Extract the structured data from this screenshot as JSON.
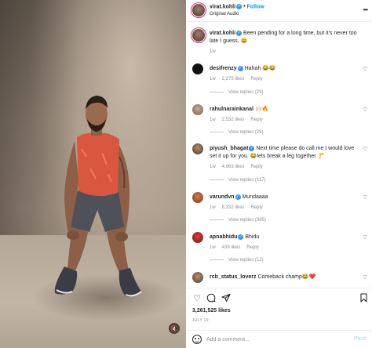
{
  "post": {
    "username": "virat.kohli",
    "follow_label": "Follow",
    "audio": "Original Audio",
    "verified_mark": "✓",
    "more_label": "•••"
  },
  "caption": {
    "username": "virat.kohli",
    "text": "Been pending for a long time, but it's never too late I guess. 😄",
    "time": "1w"
  },
  "comments": [
    {
      "username": "desifrenzy",
      "text": "Hahah 😂😂",
      "time": "1w",
      "likes": "2,275 likes",
      "reply_label": "Reply",
      "view_replies": "View replies (29)"
    },
    {
      "username": "rahulnarainkanal",
      "text": "🙌🏻🔥",
      "time": "1w",
      "likes": "2,532 likes",
      "reply_label": "Reply",
      "view_replies": "View replies (29)"
    },
    {
      "username": "piyush_bhagat",
      "text": "Next time please do call me I would love set it up for you. 😂lets break a leg together 🦵",
      "time": "1w",
      "likes": "4,963 likes",
      "reply_label": "Reply",
      "view_replies": "View replies (117)"
    },
    {
      "username": "varundvn",
      "text": "Mundaaaa",
      "time": "1w",
      "likes": "8,332 likes",
      "reply_label": "Reply",
      "view_replies": "View replies (395)"
    },
    {
      "username": "apnabhidu",
      "text": "Bhidu",
      "time": "1w",
      "likes": "439 likes",
      "reply_label": "Reply",
      "view_replies": "View replies (12)"
    },
    {
      "username": "rcb_status_loverz",
      "text": "Comeback champ😂❤️"
    }
  ],
  "footer": {
    "likes": "3,261,525 likes",
    "date": "JULY 19",
    "comment_placeholder": "Add a comment...",
    "post_label": "Post"
  },
  "icons": {
    "heart": "heart-icon",
    "comment": "comment-icon",
    "share": "share-icon",
    "save": "bookmark-icon",
    "mute": "muted-speaker-icon"
  },
  "colors": {
    "follow": "#0095f6",
    "verified": "#3897f0",
    "post_disabled": "#b2dffc"
  }
}
